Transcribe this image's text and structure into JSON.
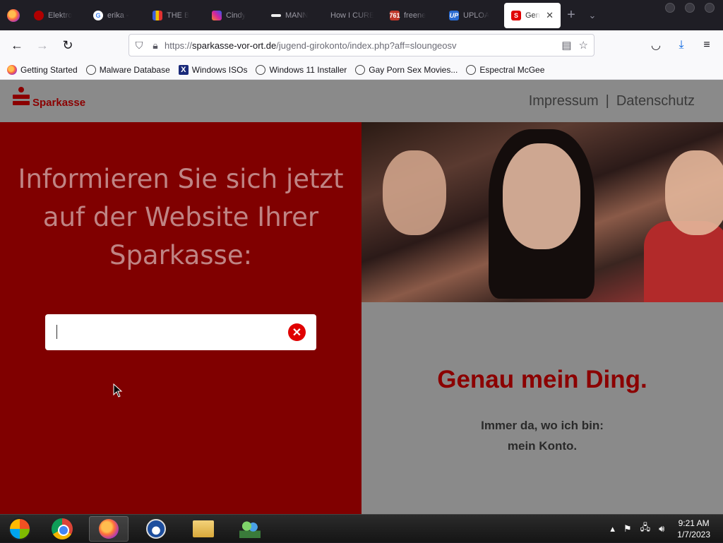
{
  "browser": {
    "tabs": [
      {
        "label": "Elektro",
        "favicon_color": "#b00000"
      },
      {
        "label": "erika -",
        "favicon_color": "#4285f4"
      },
      {
        "label": "THE B",
        "favicon_color": "#f0c000"
      },
      {
        "label": "Cindy",
        "favicon_color": "#d6249f"
      },
      {
        "label": "MANN",
        "favicon_color": "#333333"
      },
      {
        "label": "How I CURE",
        "favicon_color": "#1f1e25"
      },
      {
        "label": "freene",
        "favicon_color": "#c0392b",
        "favicon_text": "761"
      },
      {
        "label": "UPLOA",
        "favicon_color": "#2a6bd1",
        "favicon_text": "UP"
      }
    ],
    "active_tab": {
      "label": "Gen",
      "favicon_color": "#e00000"
    },
    "url": {
      "protocol": "https://",
      "host": "sparkasse-vor-ort.de",
      "path": "/jugend-girokonto/index.php?aff=sloungeosv"
    },
    "bookmarks": [
      {
        "label": "Getting Started",
        "icon": "firefox-icon"
      },
      {
        "label": "Malware Database",
        "icon": "globe-icon"
      },
      {
        "label": "Windows ISOs",
        "icon": "x-icon"
      },
      {
        "label": "Windows 11 Installer",
        "icon": "globe-icon"
      },
      {
        "label": "Gay Porn Sex Movies...",
        "icon": "globe-icon"
      },
      {
        "label": "Espectral McGee",
        "icon": "globe-icon"
      }
    ]
  },
  "page": {
    "brand": "Sparkasse",
    "nav": {
      "impressum": "Impressum",
      "separator": "|",
      "datenschutz": "Datenschutz"
    },
    "headline": "Informieren Sie sich jetzt auf der Website Ihrer Sparkasse:",
    "search": {
      "value": ""
    },
    "slogan": "Genau mein Ding.",
    "sub_line1": "Immer da, wo ich bin:",
    "sub_line2": "mein Konto.",
    "colors": {
      "brand_red": "#8b0000",
      "panel_red": "#800000",
      "gray": "#8a8a8a"
    }
  },
  "taskbar": {
    "time": "9:21 AM",
    "date": "1/7/2023"
  }
}
